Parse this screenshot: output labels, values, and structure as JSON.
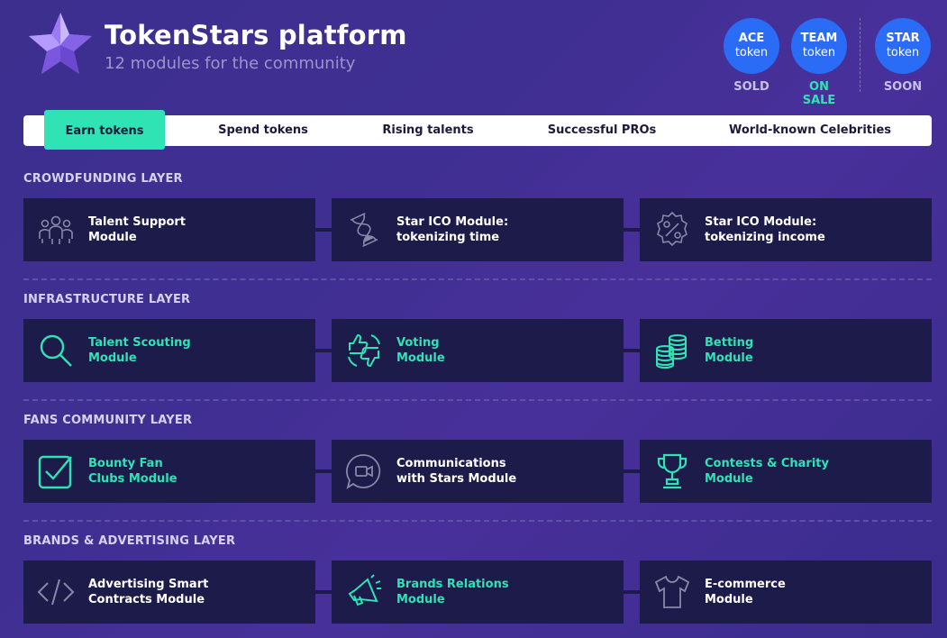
{
  "header": {
    "title": "TokenStars platform",
    "subtitle": "12 modules for the community"
  },
  "tokens": [
    {
      "name": "ACE",
      "word": "token",
      "status": "SOLD"
    },
    {
      "name": "TEAM",
      "word": "token",
      "status": "ON SALE"
    },
    {
      "name": "STAR",
      "word": "token",
      "status": "SOON"
    }
  ],
  "tabs": [
    {
      "label": "Earn tokens",
      "active": true
    },
    {
      "label": "Spend tokens"
    },
    {
      "label": "Rising talents"
    },
    {
      "label": "Successful PROs"
    },
    {
      "label": "World-known Celebrities"
    }
  ],
  "layers": [
    {
      "title": "CROWDFUNDING LAYER",
      "modules": [
        {
          "label": "Talent Support\nModule",
          "icon": "people-group-icon",
          "accent": false
        },
        {
          "label": "Star ICO Module:\ntokenizing time",
          "icon": "hourglass-icon",
          "accent": false
        },
        {
          "label": "Star ICO Module:\ntokenizing income",
          "icon": "percent-badge-icon",
          "accent": false
        }
      ]
    },
    {
      "title": "INFRASTRUCTURE LAYER",
      "modules": [
        {
          "label": "Talent Scouting\nModule",
          "icon": "search-icon",
          "accent": true
        },
        {
          "label": "Voting\nModule",
          "icon": "thumbs-vote-icon",
          "accent": true
        },
        {
          "label": "Betting\nModule",
          "icon": "coin-stacks-icon",
          "accent": true
        }
      ]
    },
    {
      "title": "FANS COMMUNITY LAYER",
      "modules": [
        {
          "label": "Bounty Fan\nClubs Module",
          "icon": "checkbox-icon",
          "accent": true
        },
        {
          "label": "Communications\nwith Stars Module",
          "icon": "video-chat-icon",
          "accent": false
        },
        {
          "label": "Contests & Charity\nModule",
          "icon": "trophy-icon",
          "accent": true
        }
      ]
    },
    {
      "title": "BRANDS & ADVERTISING LAYER",
      "modules": [
        {
          "label": "Advertising Smart\nContracts Module",
          "icon": "code-icon",
          "accent": false
        },
        {
          "label": "Brands Relations\nModule",
          "icon": "megaphone-icon",
          "accent": true
        },
        {
          "label": "E-commerce\nModule",
          "icon": "tshirt-icon",
          "accent": false
        }
      ]
    }
  ],
  "colors": {
    "accent": "#2fe3b4",
    "token_blue": "#2a6cf5",
    "card_bg": "#1c1b4a",
    "icon_gray": "#8a88a8"
  }
}
